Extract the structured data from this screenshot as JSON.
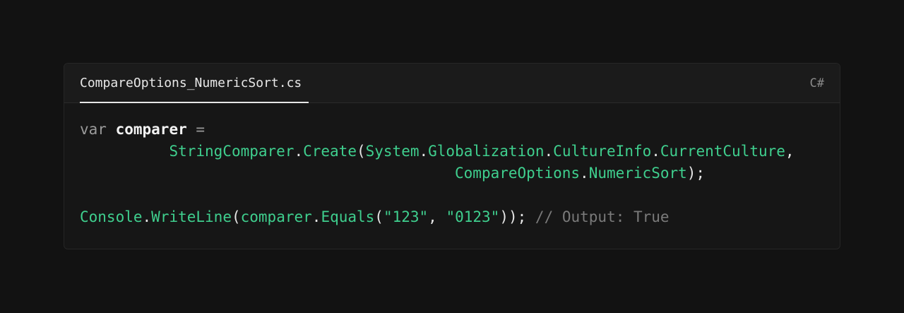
{
  "file": {
    "name": "CompareOptions_NumericSort.cs",
    "language": "C#"
  },
  "code": {
    "l1_kw": "var",
    "l1_var": "comparer",
    "l1_op": "=",
    "l2_a": "StringComparer",
    "l2_b": "Create",
    "l2_c": "System",
    "l2_d": "Globalization",
    "l2_e": "CultureInfo",
    "l2_f": "CurrentCulture",
    "l3_a": "CompareOptions",
    "l3_b": "NumericSort",
    "l5_a": "Console",
    "l5_b": "WriteLine",
    "l5_c": "comparer",
    "l5_d": "Equals",
    "l5_s1": "\"123\"",
    "l5_s2": "\"0123\"",
    "l5_comment": "// Output: True"
  },
  "colors": {
    "background": "#121212",
    "identifier": "#3fcf8e",
    "comment": "#7a7a7a"
  }
}
